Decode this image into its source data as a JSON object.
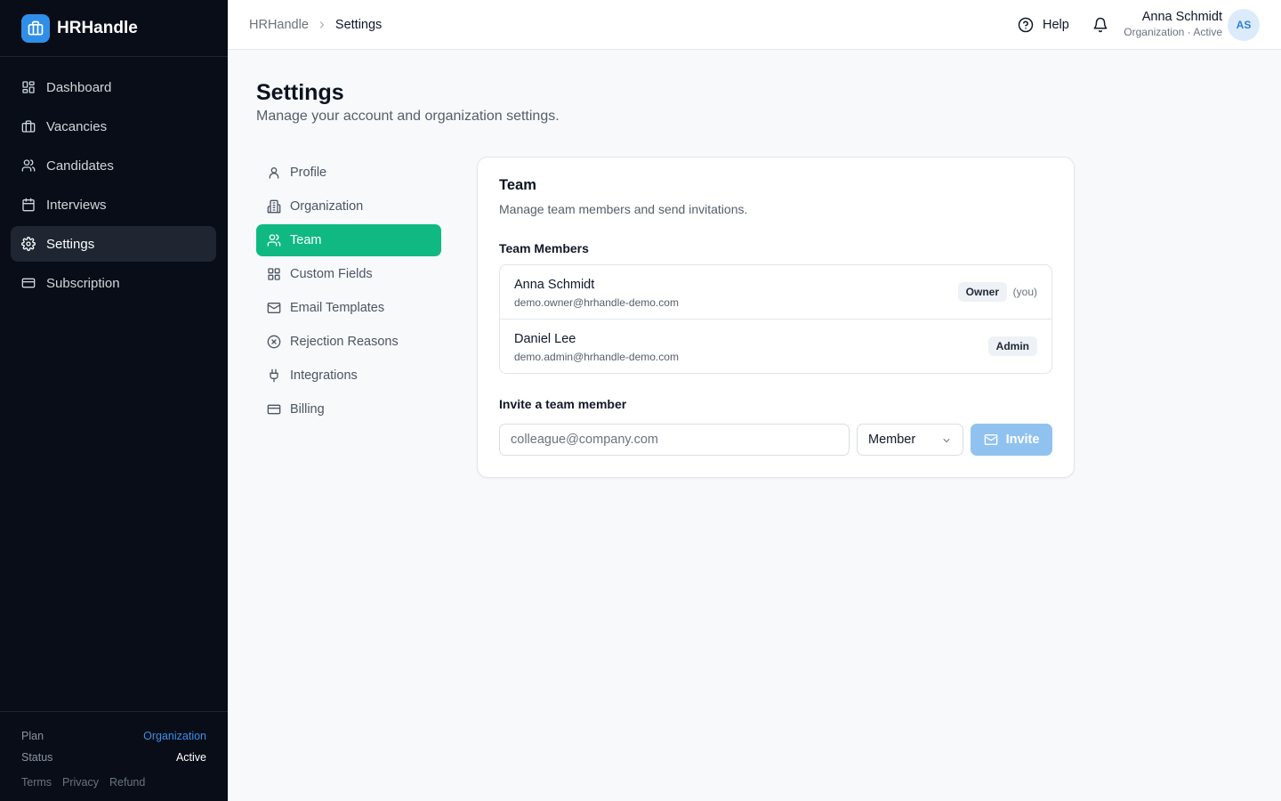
{
  "brand": {
    "name": "HRHandle"
  },
  "sidebar": {
    "items": [
      {
        "label": "Dashboard",
        "icon": "dashboard-icon"
      },
      {
        "label": "Vacancies",
        "icon": "briefcase-icon"
      },
      {
        "label": "Candidates",
        "icon": "users-icon"
      },
      {
        "label": "Interviews",
        "icon": "calendar-icon"
      },
      {
        "label": "Settings",
        "icon": "gear-icon",
        "active": true
      },
      {
        "label": "Subscription",
        "icon": "credit-card-icon"
      }
    ],
    "footer": {
      "plan_label": "Plan",
      "plan_value": "Organization",
      "status_label": "Status",
      "status_value": "Active",
      "links": [
        "Terms",
        "Privacy",
        "Refund"
      ]
    }
  },
  "header": {
    "breadcrumb": [
      "HRHandle",
      "Settings"
    ],
    "help_label": "Help",
    "user": {
      "name": "Anna Schmidt",
      "subtitle": "Organization · Active",
      "initials": "AS"
    }
  },
  "page": {
    "title": "Settings",
    "subtitle": "Manage your account and organization settings."
  },
  "settings_nav": [
    {
      "label": "Profile",
      "icon": "user-icon"
    },
    {
      "label": "Organization",
      "icon": "building-icon"
    },
    {
      "label": "Team",
      "icon": "users-icon",
      "active": true
    },
    {
      "label": "Custom Fields",
      "icon": "grid-icon"
    },
    {
      "label": "Email Templates",
      "icon": "mail-icon"
    },
    {
      "label": "Rejection Reasons",
      "icon": "circle-x-icon"
    },
    {
      "label": "Integrations",
      "icon": "plug-icon"
    },
    {
      "label": "Billing",
      "icon": "credit-card-icon"
    }
  ],
  "team": {
    "title": "Team",
    "description": "Manage team members and send invitations.",
    "members_heading": "Team Members",
    "members": [
      {
        "name": "Anna Schmidt",
        "email": "demo.owner@hrhandle-demo.com",
        "role": "Owner",
        "you_label": "(you)"
      },
      {
        "name": "Daniel Lee",
        "email": "demo.admin@hrhandle-demo.com",
        "role": "Admin"
      }
    ],
    "invite": {
      "heading": "Invite a team member",
      "placeholder": "colleague@company.com",
      "role": "Member",
      "button_label": "Invite"
    }
  },
  "colors": {
    "sidebar_bg": "#080d17",
    "accent_green": "#10b981",
    "brand_blue": "#2f8fe8",
    "invite_button": "#90c2f0"
  }
}
